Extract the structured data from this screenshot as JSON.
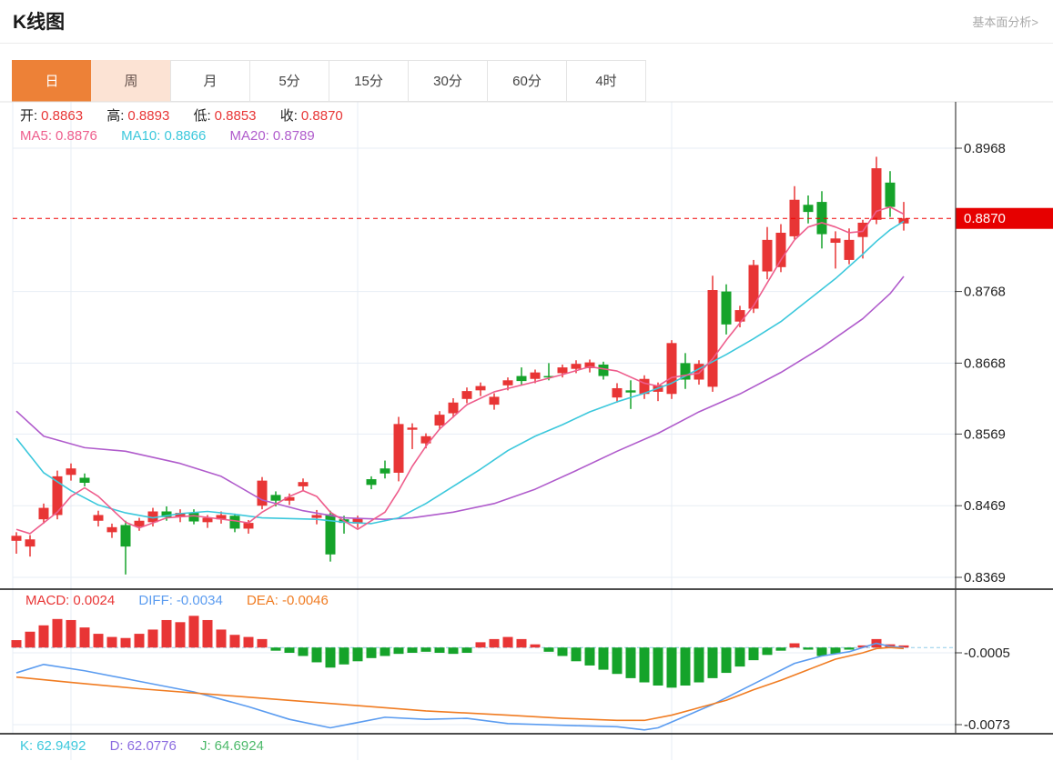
{
  "page": {
    "title": "K线图",
    "fundamental_link": "基本面分析>"
  },
  "tabs": [
    {
      "label": "日",
      "state": "active"
    },
    {
      "label": "周",
      "state": "highlight"
    },
    {
      "label": "月",
      "state": ""
    },
    {
      "label": "5分",
      "state": ""
    },
    {
      "label": "15分",
      "state": ""
    },
    {
      "label": "30分",
      "state": ""
    },
    {
      "label": "60分",
      "state": ""
    },
    {
      "label": "4时",
      "state": ""
    }
  ],
  "kline_legend": {
    "open_label": "开:",
    "open": "0.8863",
    "high_label": "高:",
    "high": "0.8893",
    "low_label": "低:",
    "low": "0.8853",
    "close_label": "收:",
    "close": "0.8870",
    "ma5_label": "MA5:",
    "ma5": "0.8876",
    "ma10_label": "MA10:",
    "ma10": "0.8866",
    "ma20_label": "MA20:",
    "ma20": "0.8789"
  },
  "macd_legend": {
    "macd_label": "MACD:",
    "macd": "0.0024",
    "diff_label": "DIFF:",
    "diff": "-0.0034",
    "dea_label": "DEA:",
    "dea": "-0.0046"
  },
  "kdj_legend": {
    "k_label": "K:",
    "k": "62.9492",
    "d_label": "D:",
    "d": "62.0776",
    "j_label": "J:",
    "j": "64.6924"
  },
  "colors": {
    "up": "#e83535",
    "down": "#15a32a",
    "ma5": "#ee5d8c",
    "ma10": "#3cc8dc",
    "ma20": "#b05ccc",
    "diff": "#5b9cf0",
    "dea": "#f07c22",
    "price_line": "#f00000",
    "price_badge": "#e60000",
    "badge_text": "#ffffff",
    "grid": "#e7edf4",
    "axis": "#3f3f3f",
    "divider": "#111111",
    "zero_line": "#8fcbe9",
    "tab_active": "#ed8137",
    "tab_week": "#fce3d4",
    "kdj_k": "#3cc8dc",
    "kdj_d": "#8b6be0",
    "kdj_j": "#4cb96a"
  },
  "chart_data": {
    "type": "candlestick",
    "panels": [
      "kline",
      "macd",
      "kdj"
    ],
    "x_count": 66,
    "kline": {
      "axis_ticks": [
        "0.8968",
        "0.8768",
        "0.8668",
        "0.8569",
        "0.8469",
        "0.8369"
      ],
      "axis_tick_values": [
        0.8968,
        0.8768,
        0.8668,
        0.8569,
        0.8469,
        0.8369
      ],
      "current_price": "0.8870",
      "current_price_value": 0.887,
      "candles": [
        [
          0.842,
          0.8432,
          0.8402,
          0.8427
        ],
        [
          0.8412,
          0.8428,
          0.8398,
          0.8422
        ],
        [
          0.845,
          0.8472,
          0.8444,
          0.8466
        ],
        [
          0.8456,
          0.8518,
          0.845,
          0.851
        ],
        [
          0.8512,
          0.8528,
          0.8504,
          0.8521
        ],
        [
          0.8508,
          0.8514,
          0.8496,
          0.8501
        ],
        [
          0.8448,
          0.8462,
          0.844,
          0.8456
        ],
        [
          0.8432,
          0.8444,
          0.8424,
          0.8439
        ],
        [
          0.8442,
          0.8448,
          0.8373,
          0.8412
        ],
        [
          0.844,
          0.8452,
          0.8434,
          0.8448
        ],
        [
          0.8446,
          0.8466,
          0.844,
          0.8461
        ],
        [
          0.8461,
          0.8468,
          0.8448,
          0.8453
        ],
        [
          0.8453,
          0.8464,
          0.8446,
          0.8459
        ],
        [
          0.8459,
          0.8464,
          0.8443,
          0.8447
        ],
        [
          0.8446,
          0.8456,
          0.8438,
          0.8452
        ],
        [
          0.845,
          0.8461,
          0.8444,
          0.8456
        ],
        [
          0.8455,
          0.8458,
          0.8432,
          0.8437
        ],
        [
          0.8437,
          0.8449,
          0.843,
          0.8445
        ],
        [
          0.8469,
          0.8509,
          0.8464,
          0.8504
        ],
        [
          0.8484,
          0.8489,
          0.8468,
          0.8476
        ],
        [
          0.8476,
          0.8486,
          0.847,
          0.8481
        ],
        [
          0.8496,
          0.8507,
          0.849,
          0.8502
        ],
        [
          0.8452,
          0.8463,
          0.8443,
          0.8456
        ],
        [
          0.8457,
          0.8462,
          0.8391,
          0.8401
        ],
        [
          0.845,
          0.8455,
          0.843,
          0.8445
        ],
        [
          0.8444,
          0.8455,
          0.8438,
          0.8452
        ],
        [
          0.8506,
          0.851,
          0.8492,
          0.8498
        ],
        [
          0.8521,
          0.8532,
          0.8507,
          0.8514
        ],
        [
          0.8515,
          0.8593,
          0.8503,
          0.8583
        ],
        [
          0.8575,
          0.8584,
          0.8548,
          0.8578
        ],
        [
          0.8556,
          0.857,
          0.8549,
          0.8566
        ],
        [
          0.8581,
          0.8601,
          0.8575,
          0.8596
        ],
        [
          0.8598,
          0.8619,
          0.8592,
          0.8613
        ],
        [
          0.8618,
          0.8634,
          0.8612,
          0.8629
        ],
        [
          0.863,
          0.8641,
          0.8622,
          0.8636
        ],
        [
          0.861,
          0.8626,
          0.8603,
          0.8621
        ],
        [
          0.8637,
          0.8648,
          0.863,
          0.8644
        ],
        [
          0.865,
          0.8662,
          0.8638,
          0.8643
        ],
        [
          0.8646,
          0.8659,
          0.864,
          0.8655
        ],
        [
          0.865,
          0.8668,
          0.8644,
          0.8648
        ],
        [
          0.8654,
          0.8666,
          0.8648,
          0.8662
        ],
        [
          0.866,
          0.8672,
          0.8654,
          0.8667
        ],
        [
          0.8661,
          0.8673,
          0.8655,
          0.8669
        ],
        [
          0.8666,
          0.867,
          0.8645,
          0.865
        ],
        [
          0.862,
          0.864,
          0.8613,
          0.8633
        ],
        [
          0.863,
          0.8644,
          0.8604,
          0.8627
        ],
        [
          0.8625,
          0.8651,
          0.8618,
          0.8646
        ],
        [
          0.8628,
          0.8641,
          0.8615,
          0.8637
        ],
        [
          0.8625,
          0.87,
          0.8618,
          0.8696
        ],
        [
          0.8668,
          0.8682,
          0.8632,
          0.8645
        ],
        [
          0.8645,
          0.8672,
          0.8638,
          0.8667
        ],
        [
          0.8635,
          0.879,
          0.8628,
          0.877
        ],
        [
          0.8768,
          0.8778,
          0.8708,
          0.8722
        ],
        [
          0.8726,
          0.8748,
          0.8718,
          0.8742
        ],
        [
          0.8744,
          0.8812,
          0.8738,
          0.8805
        ],
        [
          0.8796,
          0.8858,
          0.8785,
          0.884
        ],
        [
          0.8802,
          0.8862,
          0.8795,
          0.885
        ],
        [
          0.8845,
          0.8915,
          0.8841,
          0.8896
        ],
        [
          0.8889,
          0.8902,
          0.8863,
          0.8879
        ],
        [
          0.8893,
          0.8908,
          0.8828,
          0.8848
        ],
        [
          0.8836,
          0.8852,
          0.88,
          0.8842
        ],
        [
          0.8812,
          0.8856,
          0.8806,
          0.884
        ],
        [
          0.8844,
          0.8868,
          0.8814,
          0.8864
        ],
        [
          0.8868,
          0.8956,
          0.8862,
          0.894
        ],
        [
          0.892,
          0.8936,
          0.8872,
          0.8886
        ],
        [
          0.8863,
          0.8893,
          0.8853,
          0.887
        ]
      ],
      "ma5": [
        [
          0,
          0.8436
        ],
        [
          1,
          0.843
        ],
        [
          3,
          0.846
        ],
        [
          4,
          0.8482
        ],
        [
          5,
          0.8494
        ],
        [
          6,
          0.8482
        ],
        [
          8,
          0.8446
        ],
        [
          9,
          0.8438
        ],
        [
          11,
          0.8452
        ],
        [
          13,
          0.8455
        ],
        [
          16,
          0.8448
        ],
        [
          17,
          0.8445
        ],
        [
          18,
          0.846
        ],
        [
          20,
          0.8482
        ],
        [
          21,
          0.849
        ],
        [
          22,
          0.8482
        ],
        [
          23,
          0.846
        ],
        [
          25,
          0.8436
        ],
        [
          27,
          0.846
        ],
        [
          28,
          0.849
        ],
        [
          29,
          0.8524
        ],
        [
          30,
          0.8552
        ],
        [
          31,
          0.8576
        ],
        [
          33,
          0.861
        ],
        [
          35,
          0.8628
        ],
        [
          38,
          0.8642
        ],
        [
          40,
          0.8652
        ],
        [
          42,
          0.8663
        ],
        [
          44,
          0.8657
        ],
        [
          46,
          0.864
        ],
        [
          47,
          0.8636
        ],
        [
          48,
          0.8648
        ],
        [
          50,
          0.8654
        ],
        [
          51,
          0.8674
        ],
        [
          52,
          0.87
        ],
        [
          54,
          0.8748
        ],
        [
          56,
          0.8812
        ],
        [
          57,
          0.884
        ],
        [
          58,
          0.8858
        ],
        [
          59,
          0.8864
        ],
        [
          60,
          0.8858
        ],
        [
          61,
          0.885
        ],
        [
          62,
          0.8852
        ],
        [
          63,
          0.888
        ],
        [
          64,
          0.8886
        ],
        [
          65,
          0.8876
        ]
      ],
      "ma10": [
        [
          0,
          0.8563
        ],
        [
          2,
          0.8515
        ],
        [
          4,
          0.849
        ],
        [
          6,
          0.847
        ],
        [
          8,
          0.8459
        ],
        [
          10,
          0.8452
        ],
        [
          12,
          0.8458
        ],
        [
          14,
          0.8461
        ],
        [
          16,
          0.8457
        ],
        [
          18,
          0.8452
        ],
        [
          22,
          0.845
        ],
        [
          24,
          0.8446
        ],
        [
          26,
          0.8444
        ],
        [
          28,
          0.8452
        ],
        [
          30,
          0.8472
        ],
        [
          32,
          0.8496
        ],
        [
          34,
          0.852
        ],
        [
          36,
          0.8546
        ],
        [
          38,
          0.8566
        ],
        [
          40,
          0.8582
        ],
        [
          42,
          0.86
        ],
        [
          44,
          0.8614
        ],
        [
          46,
          0.8626
        ],
        [
          48,
          0.864
        ],
        [
          50,
          0.866
        ],
        [
          52,
          0.868
        ],
        [
          54,
          0.8702
        ],
        [
          56,
          0.8726
        ],
        [
          58,
          0.8756
        ],
        [
          60,
          0.8786
        ],
        [
          62,
          0.882
        ],
        [
          63,
          0.8838
        ],
        [
          64,
          0.8854
        ],
        [
          65,
          0.8866
        ]
      ],
      "ma20": [
        [
          0,
          0.8601
        ],
        [
          2,
          0.8566
        ],
        [
          5,
          0.855
        ],
        [
          8,
          0.8545
        ],
        [
          12,
          0.8528
        ],
        [
          15,
          0.851
        ],
        [
          18,
          0.8477
        ],
        [
          21,
          0.8462
        ],
        [
          24,
          0.8452
        ],
        [
          27,
          0.845
        ],
        [
          29,
          0.8452
        ],
        [
          32,
          0.846
        ],
        [
          35,
          0.8472
        ],
        [
          38,
          0.8492
        ],
        [
          41,
          0.8518
        ],
        [
          44,
          0.8545
        ],
        [
          47,
          0.857
        ],
        [
          50,
          0.86
        ],
        [
          53,
          0.8625
        ],
        [
          56,
          0.8655
        ],
        [
          59,
          0.869
        ],
        [
          62,
          0.873
        ],
        [
          64,
          0.8765
        ],
        [
          65,
          0.8789
        ]
      ]
    },
    "macd": {
      "axis_ticks": [
        "-0.0005",
        "-0.0073"
      ],
      "axis_tick_values": [
        -0.0005,
        -0.0073
      ],
      "hist": [
        0.0007,
        0.0015,
        0.0021,
        0.0027,
        0.0026,
        0.0019,
        0.0013,
        0.001,
        0.0009,
        0.0013,
        0.0017,
        0.0026,
        0.0024,
        0.003,
        0.0026,
        0.0017,
        0.0012,
        0.001,
        0.0008,
        -0.0003,
        -0.0005,
        -0.0008,
        -0.0014,
        -0.0019,
        -0.0016,
        -0.0013,
        -0.001,
        -0.0008,
        -0.0006,
        -0.0005,
        -0.0004,
        -0.0005,
        -0.0006,
        -0.0005,
        0.0005,
        0.0008,
        0.001,
        0.0008,
        0.0003,
        -0.0004,
        -0.0008,
        -0.0013,
        -0.0017,
        -0.0021,
        -0.0025,
        -0.0029,
        -0.0033,
        -0.0036,
        -0.0038,
        -0.0036,
        -0.0033,
        -0.0029,
        -0.0024,
        -0.0018,
        -0.0012,
        -0.0007,
        -0.0003,
        0.0004,
        -0.0002,
        -0.0008,
        -0.0006,
        -0.0002,
        0.0002,
        0.0008,
        0.0003,
        0.0002
      ],
      "diff": [
        [
          0,
          -0.0024
        ],
        [
          2,
          -0.0016
        ],
        [
          5,
          -0.0022
        ],
        [
          9,
          -0.0032
        ],
        [
          13,
          -0.0042
        ],
        [
          17,
          -0.0056
        ],
        [
          20,
          -0.0068
        ],
        [
          23,
          -0.0076
        ],
        [
          25,
          -0.0071
        ],
        [
          27,
          -0.0066
        ],
        [
          30,
          -0.0068
        ],
        [
          33,
          -0.0067
        ],
        [
          36,
          -0.0072
        ],
        [
          41,
          -0.0074
        ],
        [
          44,
          -0.0075
        ],
        [
          46,
          -0.0078
        ],
        [
          47,
          -0.0076
        ],
        [
          49,
          -0.0065
        ],
        [
          51,
          -0.0054
        ],
        [
          53,
          -0.0041
        ],
        [
          55,
          -0.0028
        ],
        [
          57,
          -0.0015
        ],
        [
          59,
          -0.0008
        ],
        [
          61,
          -0.0004
        ],
        [
          62,
          0.0
        ],
        [
          63,
          0.0004
        ],
        [
          64,
          0.0001
        ],
        [
          65,
          0.0
        ]
      ],
      "dea": [
        [
          0,
          -0.0028
        ],
        [
          4,
          -0.0033
        ],
        [
          9,
          -0.0039
        ],
        [
          14,
          -0.0044
        ],
        [
          20,
          -0.005
        ],
        [
          25,
          -0.0055
        ],
        [
          30,
          -0.006
        ],
        [
          36,
          -0.0064
        ],
        [
          40,
          -0.0067
        ],
        [
          44,
          -0.0069
        ],
        [
          46,
          -0.0069
        ],
        [
          48,
          -0.0064
        ],
        [
          50,
          -0.0057
        ],
        [
          52,
          -0.005
        ],
        [
          54,
          -0.004
        ],
        [
          56,
          -0.0031
        ],
        [
          58,
          -0.0021
        ],
        [
          60,
          -0.0011
        ],
        [
          62,
          -0.0005
        ],
        [
          63,
          -0.0001
        ],
        [
          64,
          0.0
        ],
        [
          65,
          -0.0001
        ]
      ]
    }
  }
}
